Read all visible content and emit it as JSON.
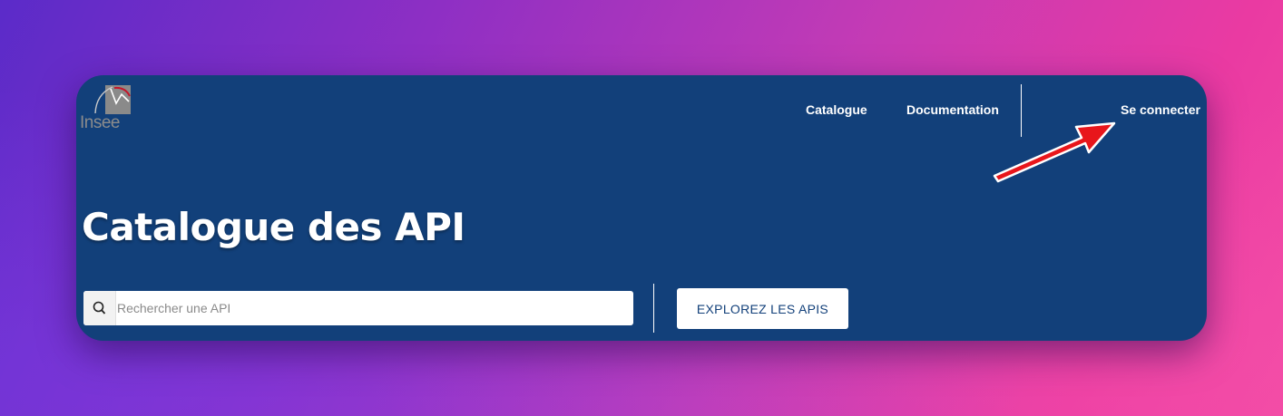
{
  "brand": {
    "logo_text": "Insee"
  },
  "nav": {
    "catalogue": "Catalogue",
    "documentation": "Documentation",
    "login": "Se connecter"
  },
  "hero": {
    "title": "Catalogue des API"
  },
  "search": {
    "placeholder": "Rechercher une API",
    "value": ""
  },
  "actions": {
    "explore": "EXPLOREZ LES APIS"
  },
  "colors": {
    "header_bg": "#12407a",
    "text_on_header": "#ffffff",
    "annotation_arrow": "#e8161b"
  },
  "annotation": {
    "arrow_icon": "arrow-pointer-icon",
    "points_to": "Se connecter"
  }
}
